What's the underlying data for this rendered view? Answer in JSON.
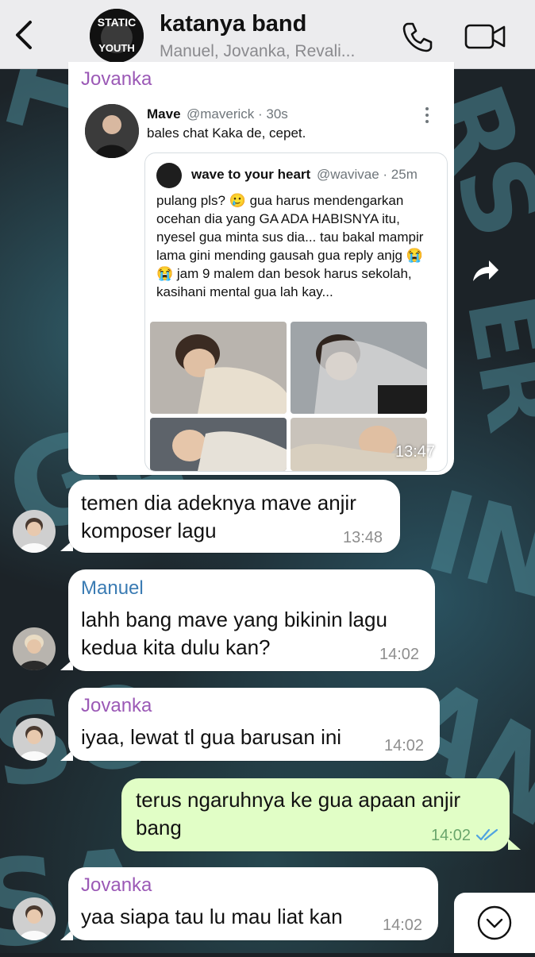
{
  "header": {
    "back_label": "back",
    "group_avatar_text_top": "STATIC",
    "group_avatar_text_bottom": "YOUTH",
    "title": "katanya band",
    "subtitle": "Manuel, Jovanka, Revali..."
  },
  "messages": [
    {
      "sender": "Jovanka",
      "tweet": {
        "name": "Mave",
        "handle": "@maverick · 30s",
        "text": "bales chat Kaka de, cepet.",
        "quoted": {
          "name": "wave to your heart",
          "handle": "@wavivae · 25m",
          "text": "pulang pls? 🥲 gua harus mendengarkan ocehan dia yang GA ADA HABISNYA itu, nyesel gua minta sus dia... tau bakal mampir lama gini mending gausah gua reply anjg 😭😭 jam 9 malem dan besok harus sekolah, kasihani mental gua lah kay..."
        }
      },
      "time": "13:47"
    },
    {
      "text": "temen dia adeknya mave anjir\nkomposer lagu",
      "time": "13:48"
    },
    {
      "sender": "Manuel",
      "text": "lahh bang mave yang bikinin lagu\nkedua kita dulu kan?",
      "time": "14:02"
    },
    {
      "sender": "Jovanka",
      "text": "iyaa, lewat tl gua barusan ini",
      "time": "14:02"
    },
    {
      "text": "terus ngaruhnya ke gua apaan anjir\nbang",
      "time": "14:02"
    },
    {
      "sender": "Jovanka",
      "text": "yaa siapa tau lu mau liat kan",
      "time": "14:02"
    }
  ],
  "colors": {
    "header_bg": "#ececee",
    "incoming_bubble": "#ffffff",
    "outgoing_bubble": "#e1fec6",
    "jovanka_name": "#9b59b6",
    "manuel_name": "#3a7bb3",
    "read_ticks": "#4fa3e0"
  }
}
